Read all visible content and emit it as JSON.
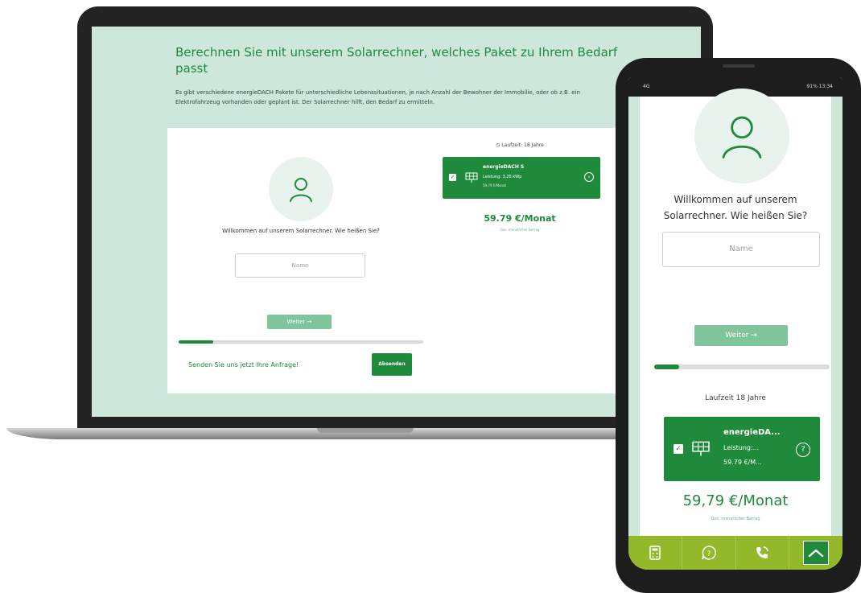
{
  "laptop": {
    "title": "Berechnen Sie mit unserem Solarrechner, welches Paket zu Ihrem Bedarf passt",
    "description": "Es gibt verschiedene energieDACH Pakete für unterschiedliche Lebenssituationen, je nach Anzahl der Bewohner der Immobilie, oder ob z.B. ein Elektrofahrzeug vorhanden oder geplant ist. Der Solarrechner hilft, den Bedarf zu ermitteln.",
    "question": "Willkommen auf unserem Solarrechner. Wie heißen Sie?",
    "name_placeholder": "Name",
    "next_label": "Weiter",
    "progress_fraction": 0.14,
    "send_prompt": "Senden Sie uns jetzt Ihre Anfrage!",
    "send_button": "Absenden",
    "laufzeit": "Laufzeit: 18 Jahre",
    "package": {
      "name": "energieDACH S",
      "leistung": "Leistung: 3,26 kWp",
      "monthly": "59,79 €/Monat"
    },
    "price": "59.79 €/Monat",
    "price_sub": "Ges. monatlicher Betrag"
  },
  "phone": {
    "status_left": "4G",
    "status_right": "91% 13:34",
    "question": "Willkommen auf unserem Solarrechner. Wie heißen Sie?",
    "name_placeholder": "Name",
    "next_label": "Weiter",
    "progress_fraction": 0.14,
    "laufzeit": "Laufzeit 18 Jahre",
    "package": {
      "name": "energieDA...",
      "leistung": "Leistung:...",
      "monthly": "59.79 €/M..."
    },
    "price": "59,79 €/Monat",
    "price_sub": "Ges. monatlicher Betrag",
    "nav": [
      "calculator-icon",
      "help-chat-icon",
      "phone-icon",
      "home-roof-icon"
    ],
    "colors": {
      "brand_green": "#1f8a3c",
      "nav_green": "#93b92a",
      "bg_mint": "#cde7db"
    }
  }
}
